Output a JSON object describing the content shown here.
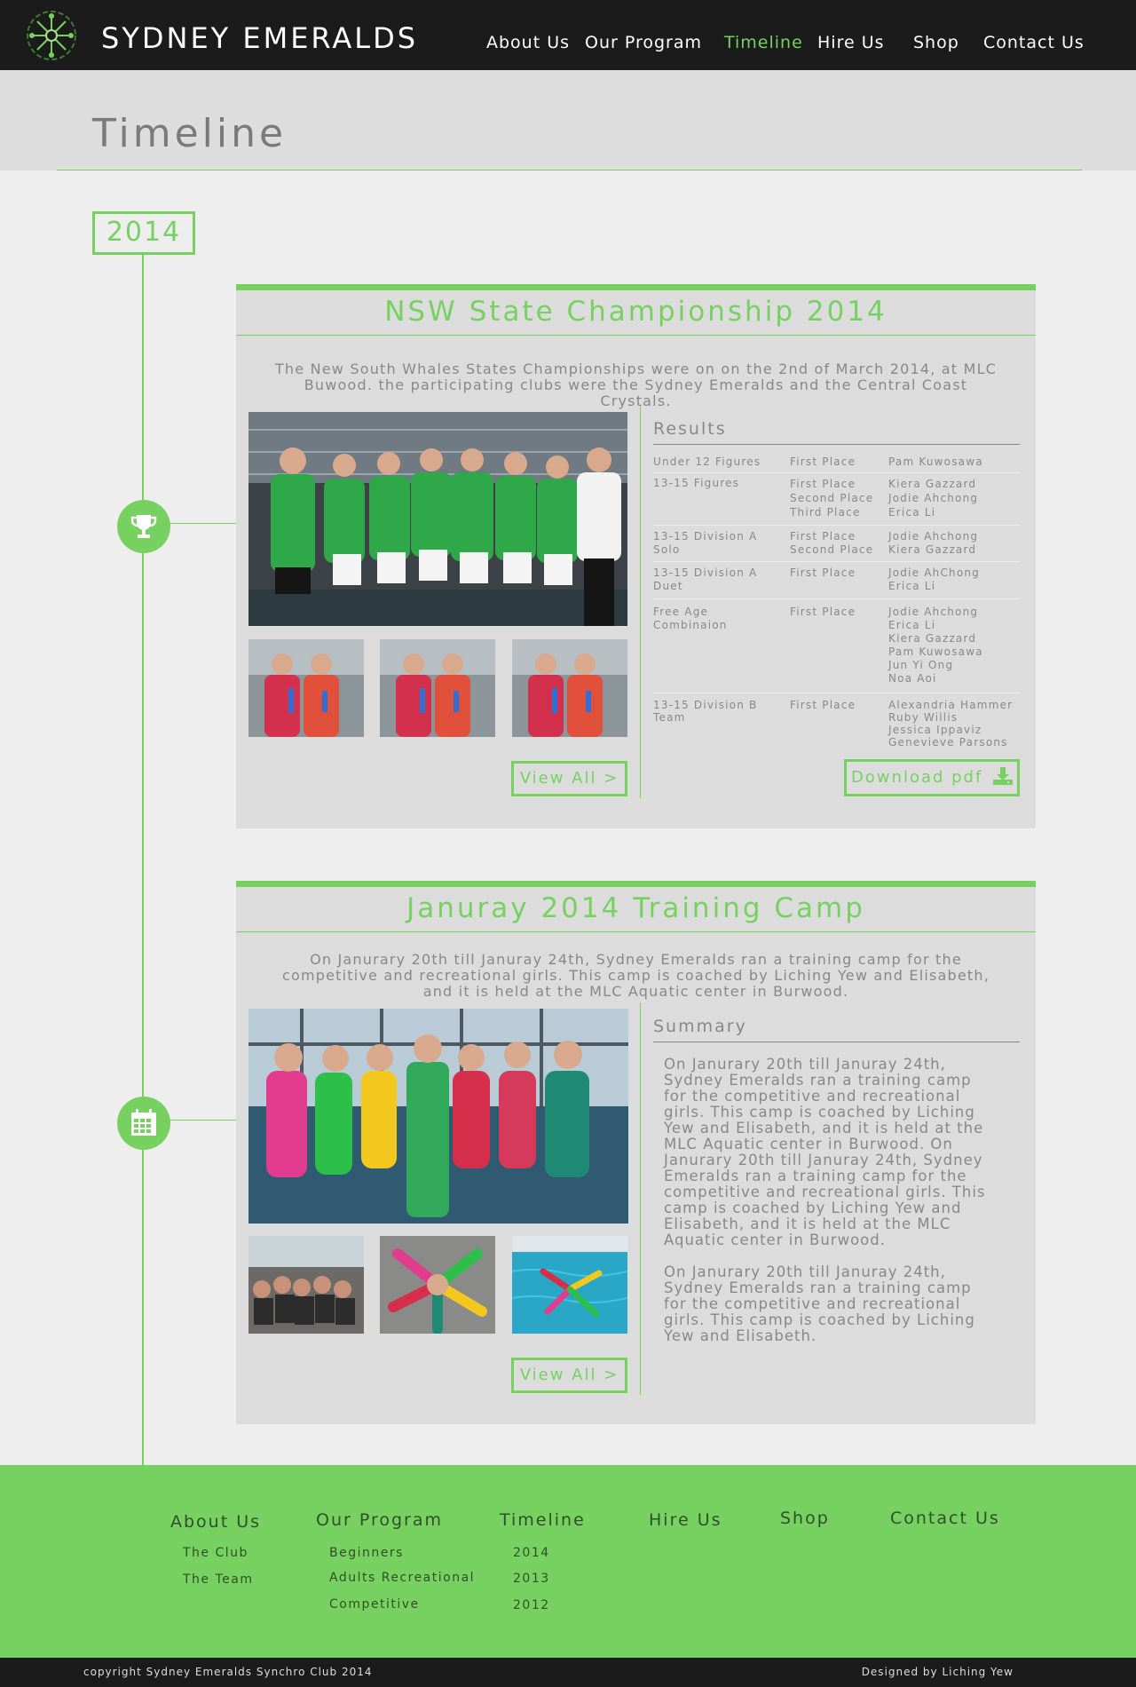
{
  "header": {
    "brand": "SYDNEY EMERALDS",
    "nav": [
      {
        "label": "About Us"
      },
      {
        "label": "Our Program"
      },
      {
        "label": "Timeline",
        "active": true
      },
      {
        "label": "Hire Us"
      },
      {
        "label": "Shop"
      },
      {
        "label": "Contact Us"
      }
    ]
  },
  "page": {
    "title": "Timeline",
    "year": "2014"
  },
  "events": [
    {
      "icon": "trophy-icon",
      "title": "NSW State Championship 2014",
      "description": "The New South Whales States Championships were on on the 2nd of March 2014, at  MLC Buwood. the participating clubs were the Sydney Emeralds and the Central Coast Crystals.",
      "view_all": "View All >",
      "panel_heading": "Results",
      "results": [
        {
          "event": "Under 12 Figures",
          "places": [
            "First Place"
          ],
          "names": [
            "Pam Kuwosawa"
          ]
        },
        {
          "event": "13-15 Figures",
          "places": [
            "First Place",
            "Second Place",
            "Third Place"
          ],
          "names": [
            "Kiera Gazzard",
            "Jodie Ahchong",
            " Erica Li"
          ]
        },
        {
          "event": "13-15 Division A Solo",
          "places": [
            "First Place",
            "Second Place"
          ],
          "names": [
            "Jodie Ahchong",
            " Kiera Gazzard"
          ]
        },
        {
          "event": "13-15 Division A Duet",
          "places": [
            "First Place"
          ],
          "names": [
            "Jodie AhChong",
            "Erica Li"
          ]
        },
        {
          "event": "Free Age Combinaion",
          "places": [
            "First Place"
          ],
          "names": [
            "Jodie Ahchong",
            " Erica Li",
            " Kiera Gazzard",
            " Pam Kuwosawa",
            " Jun Yi Ong",
            " Noa Aoi"
          ]
        },
        {
          "event": "13-15 Division B Team",
          "places": [
            "First Place"
          ],
          "names": [
            "Alexandria Hammer",
            "Ruby Willis",
            "Jessica Ippaviz",
            "Genevieve Parsons"
          ]
        }
      ],
      "download": "Download pdf"
    },
    {
      "icon": "calendar-icon",
      "title": "Januray 2014 Training Camp",
      "description": "On Janurary 20th till Januray 24th, Sydney Emeralds ran a training camp for the competitive and recreational girls. This camp is coached by Liching Yew and Elisabeth, and it is held at the MLC Aquatic center in Burwood.",
      "view_all": "View All >",
      "panel_heading": "Summary",
      "summary": [
        "On Janurary 20th till Januray 24th, Sydney Emeralds ran a training camp for the competitive and recreational girls. This camp is coached by Liching Yew and Elisabeth, and it is held at the MLC Aquatic center in Burwood. On Janurary 20th till Januray 24th, Sydney Emeralds ran a training camp for the competitive and recreational girls. This camp is coached by Liching Yew and Elisabeth, and it is held at the MLC Aquatic center in Burwood.",
        "On Janurary 20th till Januray 24th, Sydney Emeralds ran a training camp for the competitive and recreational girls. This camp is coached by Liching Yew and Elisabeth."
      ]
    }
  ],
  "footer": {
    "columns": [
      {
        "heading": "About Us",
        "links": [
          "The Club",
          "The Team"
        ]
      },
      {
        "heading": "Our Program",
        "links": [
          "Beginners",
          "Adults Recreational",
          "Competitive"
        ]
      },
      {
        "heading": "Timeline",
        "links": [
          "2014",
          "2013",
          "2012"
        ]
      },
      {
        "heading": "Hire Us",
        "links": []
      },
      {
        "heading": "Shop",
        "links": []
      },
      {
        "heading": "Contact Us",
        "links": []
      }
    ],
    "copyright": "copyright  Sydney Emeralds Synchro Club 2014",
    "designer": "Designed by Liching Yew"
  },
  "colors": {
    "accent": "#77d160",
    "header_bg": "#1b1b1b",
    "card_bg": "#dcdcdc",
    "page_bg": "#eeeeee"
  }
}
